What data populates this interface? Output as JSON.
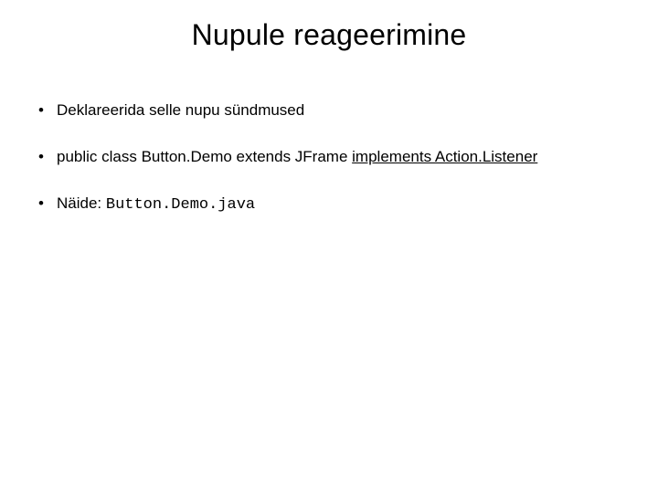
{
  "title": "Nupule reageerimine",
  "bullets": {
    "b1": "Deklareerida selle nupu sündmused",
    "b2": {
      "prefix": "public class Button.Demo extends JFrame ",
      "emph": "implements Action.Listener"
    },
    "b3": {
      "prefix": "Näide: ",
      "code": "Button.Demo.java"
    }
  }
}
